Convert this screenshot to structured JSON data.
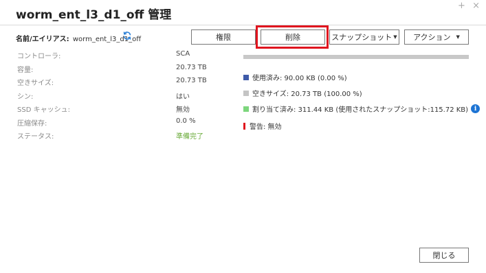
{
  "window": {
    "title": "worm_ent_l3_d1_off 管理",
    "minimize": "+",
    "close": "×"
  },
  "alias": {
    "label": "名前/エイリアス:",
    "value": "worm_ent_l3_d1_off"
  },
  "toolbar": {
    "permission": "権限",
    "delete": "削除",
    "snapshot": "スナップショット",
    "action": "アクション",
    "caret": "▼"
  },
  "properties": [
    {
      "key": "コントローラ:",
      "value": "SCA"
    },
    {
      "key": "容量:",
      "value": "20.73 TB"
    },
    {
      "key": "空きサイズ:",
      "value": "20.73 TB"
    },
    {
      "key": "シン:",
      "value": "はい"
    },
    {
      "key": "SSD キャッシュ:",
      "value": "無効"
    },
    {
      "key": "圧縮保存:",
      "value": "0.0 %"
    },
    {
      "key": "ステータス:",
      "value": "準備完了"
    }
  ],
  "usage": {
    "used_fraction": 0.0
  },
  "legend": {
    "used": "使用済み: 90.00 KB (0.00 %)",
    "free": "空きサイズ: 20.73 TB (100.00 %)",
    "allocated": "割り当て済み: 311.44 KB (使用されたスナップショット:115.72 KB)",
    "warning": "警告: 無効",
    "info": "i"
  },
  "colors": {
    "used": "#3f5ba9",
    "free": "#c4c4c4",
    "allocated": "#7dd67d",
    "warning": "#e0141e",
    "ready": "#6aab3a",
    "highlight": "#e0141e"
  },
  "footer": {
    "close": "閉じる"
  }
}
